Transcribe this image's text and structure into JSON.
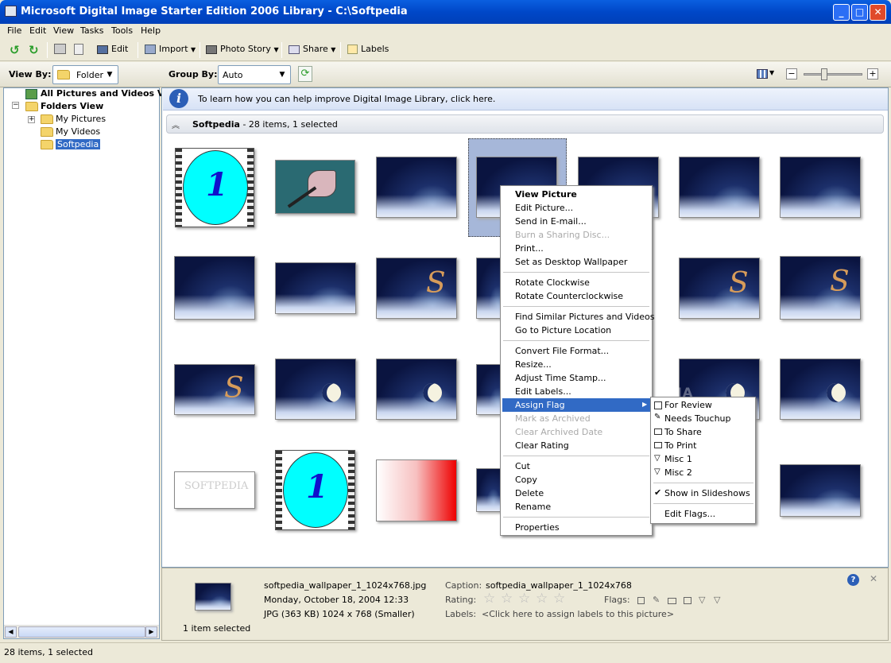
{
  "window": {
    "title": "Microsoft Digital Image Starter Edition 2006 Library - C:\\Softpedia"
  },
  "menu": [
    "File",
    "Edit",
    "View",
    "Tasks",
    "Tools",
    "Help"
  ],
  "toolbar": {
    "edit": "Edit",
    "import": "Import",
    "photo_story": "Photo Story",
    "share": "Share",
    "labels": "Labels"
  },
  "viewbar": {
    "view_by_label": "View By:",
    "view_by_value": "Folder",
    "group_by_label": "Group By:",
    "group_by_value": "Auto"
  },
  "tree": {
    "all": "All Pictures and Videos Vie",
    "folders_view": "Folders View",
    "my_pictures": "My Pictures",
    "my_videos": "My Videos",
    "softpedia": "Softpedia"
  },
  "info": "To learn how you can help improve Digital Image Library, click here.",
  "group": {
    "title": "Softpedia",
    "count": "- 28 items, 1 selected"
  },
  "context_menu": {
    "view_picture": "View Picture",
    "edit_picture": "Edit Picture...",
    "send_email": "Send in E-mail...",
    "burn": "Burn a Sharing Disc...",
    "print": "Print...",
    "wallpaper": "Set as Desktop Wallpaper",
    "rotate_cw": "Rotate Clockwise",
    "rotate_ccw": "Rotate Counterclockwise",
    "find_similar": "Find Similar Pictures and Videos",
    "go_location": "Go to Picture Location",
    "convert": "Convert File Format...",
    "resize": "Resize...",
    "adjust_time": "Adjust Time Stamp...",
    "edit_labels": "Edit Labels...",
    "assign_flag": "Assign Flag",
    "mark_archived": "Mark as Archived",
    "clear_archived": "Clear Archived Date",
    "clear_rating": "Clear Rating",
    "cut": "Cut",
    "copy": "Copy",
    "delete": "Delete",
    "rename": "Rename",
    "properties": "Properties"
  },
  "flag_menu": {
    "for_review": "For Review",
    "needs_touchup": "Needs Touchup",
    "to_share": "To Share",
    "to_print": "To Print",
    "misc1": "Misc 1",
    "misc2": "Misc 2",
    "show_slideshows": "Show in Slideshows",
    "edit_flags": "Edit Flags..."
  },
  "details": {
    "filename": "softpedia_wallpaper_1_1024x768.jpg",
    "date": "Monday, October 18, 2004 12:33",
    "format": "JPG (363 KB) 1024 x 768 (Smaller)",
    "caption_label": "Caption:",
    "caption_value": "softpedia_wallpaper_1_1024x768",
    "rating_label": "Rating:",
    "flags_label": "Flags:",
    "labels_label": "Labels:",
    "labels_value": "<Click here to assign labels to this picture>",
    "selected": "1 item selected"
  },
  "watermark": "SOFTPEDIA",
  "thumb_text": {
    "clock_numeral": "1",
    "softpedia_card": "SOFTPEDIA"
  },
  "status": "28 items, 1 selected",
  "colors": {
    "title_bar": "#0047c8",
    "menu_highlight": "#316ac5",
    "selection": "#a6b7d9"
  }
}
